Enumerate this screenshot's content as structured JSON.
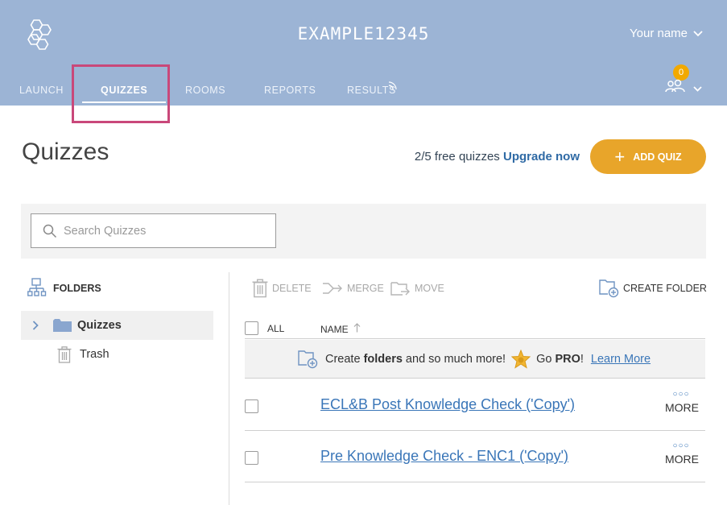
{
  "header": {
    "room_name": "EXAMPLE12345",
    "user_name": "Your name",
    "student_count": "0",
    "colors": {
      "background": "#9cb4d5",
      "badge": "#f2a900",
      "highlight": "#c9487a"
    },
    "tabs": [
      {
        "label": "LAUNCH"
      },
      {
        "label": "QUIZZES",
        "active": true
      },
      {
        "label": "ROOMS"
      },
      {
        "label": "REPORTS"
      },
      {
        "label": "RESULTS"
      }
    ]
  },
  "page": {
    "title": "Quizzes",
    "quota_text": "2/5 free quizzes",
    "upgrade_label": "Upgrade now",
    "add_quiz_label": "ADD QUIZ",
    "accent_color": "#e8a52a"
  },
  "search": {
    "placeholder": "Search Quizzes"
  },
  "sidebar": {
    "heading": "FOLDERS",
    "items": [
      {
        "label": "Quizzes",
        "icon": "folder-icon",
        "selected": true
      },
      {
        "label": "Trash",
        "icon": "trash-icon"
      }
    ]
  },
  "toolbar": {
    "delete_label": "DELETE",
    "merge_label": "MERGE",
    "move_label": "MOVE",
    "create_folder_label": "CREATE FOLDER"
  },
  "table": {
    "all_label": "ALL",
    "name_label": "NAME",
    "promo": {
      "text_before": "Create ",
      "text_bold": "folders",
      "text_after": " and so much more!",
      "go_text": "Go ",
      "pro_text": "PRO",
      "exclaim": "!",
      "learn_more": "Learn More"
    },
    "rows": [
      {
        "name": "ECL&B Post Knowledge Check ('Copy')",
        "more_label": "MORE"
      },
      {
        "name": "Pre Knowledge Check - ENC1 ('Copy')",
        "more_label": "MORE"
      }
    ]
  }
}
